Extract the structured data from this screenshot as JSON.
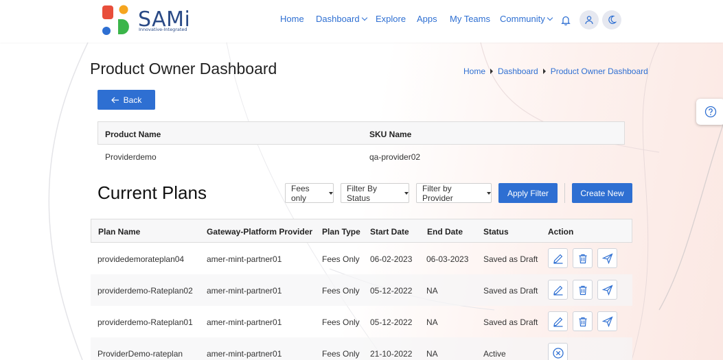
{
  "brand": {
    "name": "SAMi",
    "tagline": "Innovative-Integrated"
  },
  "nav": {
    "items": [
      "Home",
      "Dashboard",
      "Explore",
      "Apps",
      "My Teams",
      "Community"
    ],
    "icons": [
      "bell-icon",
      "user-icon",
      "moon-icon"
    ]
  },
  "page": {
    "title": "Product Owner Dashboard",
    "breadcrumb": [
      "Home",
      "Dashboard",
      "Product Owner Dashboard"
    ],
    "back_label": "Back"
  },
  "product": {
    "headers": [
      "Product Name",
      "SKU Name"
    ],
    "row": [
      "Providerdemo",
      "qa-provider02"
    ]
  },
  "plans": {
    "title": "Current Plans",
    "filters": {
      "fees": "Fees only",
      "status": "Filter By Status",
      "provider": "Filter by Provider",
      "apply_label": "Apply Filter",
      "create_label": "Create New"
    },
    "headers": [
      "Plan Name",
      "Gateway-Platform Provider",
      "Plan Type",
      "Start Date",
      "End Date",
      "Status",
      "Action"
    ],
    "rows": [
      {
        "name": "providedemorateplan04",
        "provider": "amer-mint-partner01",
        "type": "Fees Only",
        "start": "06-02-2023",
        "end": "06-03-2023",
        "status": "Saved as Draft",
        "actions": [
          "edit-icon",
          "trash-icon",
          "send-icon"
        ]
      },
      {
        "name": "providerdemo-Rateplan02",
        "provider": "amer-mint-partner01",
        "type": "Fees Only",
        "start": "05-12-2022",
        "end": "NA",
        "status": "Saved as Draft",
        "actions": [
          "edit-icon",
          "trash-icon",
          "send-icon"
        ]
      },
      {
        "name": "providerdemo-Rateplan01",
        "provider": "amer-mint-partner01",
        "type": "Fees Only",
        "start": "05-12-2022",
        "end": "NA",
        "status": "Saved as Draft",
        "actions": [
          "edit-icon",
          "trash-icon",
          "send-icon"
        ]
      },
      {
        "name": "ProviderDemo-rateplan",
        "provider": "amer-mint-partner01",
        "type": "Fees Only",
        "start": "21-10-2022",
        "end": "NA",
        "status": "Active",
        "actions": [
          "close-circle-icon"
        ]
      }
    ]
  },
  "colors": {
    "accent": "#2e6fd2",
    "brand_text": "#2a4a86"
  }
}
